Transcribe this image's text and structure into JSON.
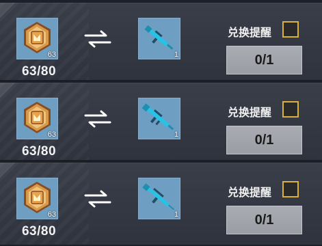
{
  "rows": [
    {
      "medal_level": "63",
      "progress": "63/80",
      "weapon_count": "1",
      "remind_label": "兑换提醒",
      "remind_checked": false,
      "exchange_count": "0/1"
    },
    {
      "medal_level": "63",
      "progress": "63/80",
      "weapon_count": "1",
      "remind_label": "兑换提醒",
      "remind_checked": false,
      "exchange_count": "0/1"
    },
    {
      "medal_level": "63",
      "progress": "63/80",
      "weapon_count": "1",
      "remind_label": "兑换提醒",
      "remind_checked": false,
      "exchange_count": "0/1"
    }
  ],
  "icons": {
    "medal": "medal-icon",
    "exchange": "exchange-arrows-icon",
    "weapon": "rifle-icon"
  },
  "colors": {
    "item_background": "#6f9ec3",
    "checkbox_border": "#d8b23a",
    "weapon_accent": "#27c3e6"
  }
}
